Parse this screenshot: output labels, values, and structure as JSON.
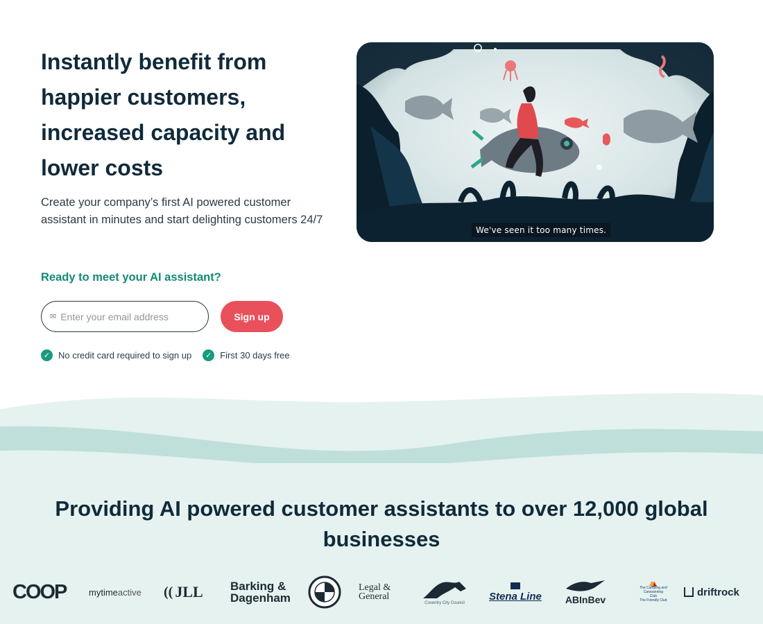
{
  "hero": {
    "title": "Instantly benefit from happier customers, increased capacity and lower costs",
    "subtitle": "Create your company’s first AI powered customer assistant in minutes and start delighting customers 24/7",
    "cta_heading": "Ready to meet your AI assistant?",
    "email_placeholder": "Enter your email address",
    "signup_label": "Sign up",
    "checks": [
      "No credit card required to sign up",
      "First 30 days free"
    ]
  },
  "video": {
    "caption": "We've seen it too many times."
  },
  "logos": {
    "title": "Providing AI powered customer assistants to over 12,000 global businesses",
    "items": {
      "coop": "COOP",
      "mytime_a": "mytime",
      "mytime_b": "active",
      "jll": "JLL",
      "barking_1": "Barking &",
      "barking_2": "Dagenham",
      "legal_1": "Legal &",
      "legal_2": "General",
      "coventry": "Coventry City Council",
      "stena": "Stena Line",
      "abinbev": "ABInBev",
      "camping_1": "The Camping and",
      "camping_2": "Caravanning",
      "camping_3": "Club",
      "camping_4": "The Friendly Club",
      "driftrock": "driftrock"
    }
  },
  "colors": {
    "accent_green": "#138a74",
    "signup_red": "#e8505b",
    "section_bg": "#e5f2f0"
  }
}
